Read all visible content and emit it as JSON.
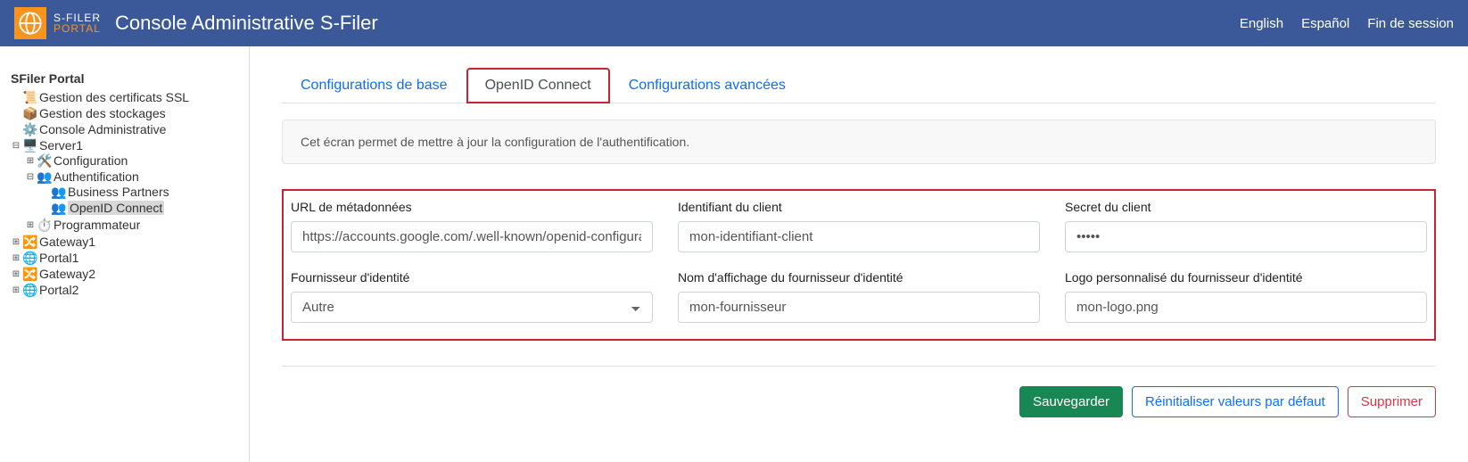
{
  "header": {
    "logo_line1": "S-FILER",
    "logo_line2": "PORTAL",
    "title": "Console Administrative S-Filer",
    "links": {
      "english": "English",
      "espanol": "Español",
      "logout": "Fin de session"
    }
  },
  "sidebar": {
    "root": "SFiler Portal",
    "items": {
      "certificats": "Gestion des certificats SSL",
      "stockages": "Gestion des stockages",
      "console": "Console Administrative",
      "server1": "Server1",
      "configuration": "Configuration",
      "auth": "Authentification",
      "bp": "Business Partners",
      "oidc": "OpenID Connect",
      "programmateur": "Programmateur",
      "gateway1": "Gateway1",
      "portal1": "Portal1",
      "gateway2": "Gateway2",
      "portal2": "Portal2"
    }
  },
  "tabs": {
    "base": "Configurations de base",
    "oidc": "OpenID Connect",
    "advanced": "Configurations avancées"
  },
  "info": "Cet écran permet de mettre à jour la configuration de l'authentification.",
  "form": {
    "metadata_url": {
      "label": "URL de métadonnées",
      "value": "https://accounts.google.com/.well-known/openid-configuration"
    },
    "client_id": {
      "label": "Identifiant du client",
      "value": "mon-identifiant-client"
    },
    "client_secret": {
      "label": "Secret du client",
      "value": "•••••"
    },
    "identity_provider": {
      "label": "Fournisseur d'identité",
      "value": "Autre"
    },
    "display_name": {
      "label": "Nom d'affichage du fournisseur d'identité",
      "value": "mon-fournisseur"
    },
    "custom_logo": {
      "label": "Logo personnalisé du fournisseur d'identité",
      "value": "mon-logo.png"
    }
  },
  "buttons": {
    "save": "Sauvegarder",
    "reset": "Réinitialiser valeurs par défaut",
    "delete": "Supprimer"
  }
}
